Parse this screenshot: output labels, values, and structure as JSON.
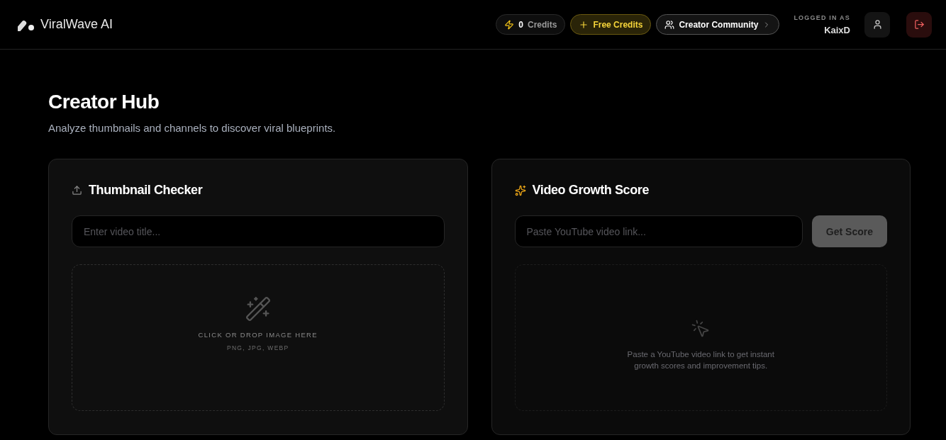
{
  "header": {
    "brand": "ViralWave AI",
    "credits": {
      "count": "0",
      "label": "Credits"
    },
    "free_credits": "Free Credits",
    "community": "Creator Community",
    "logged_in_label": "LOGGED IN AS",
    "username": "KaixD"
  },
  "page": {
    "title": "Creator Hub",
    "subtitle": "Analyze thumbnails and channels to discover viral blueprints."
  },
  "thumbnail_checker": {
    "title": "Thumbnail Checker",
    "title_field": {
      "placeholder": "Enter video title..."
    },
    "dropzone": {
      "label": "CLICK OR DROP IMAGE HERE",
      "formats": "PNG, JPG, WEBP"
    }
  },
  "growth_score": {
    "title": "Video Growth Score",
    "link_field": {
      "placeholder": "Paste YouTube video link..."
    },
    "button": {
      "label": "Get Score",
      "disabled": true
    },
    "empty_state": "Paste a YouTube video link to get instant growth scores and improvement tips."
  }
}
